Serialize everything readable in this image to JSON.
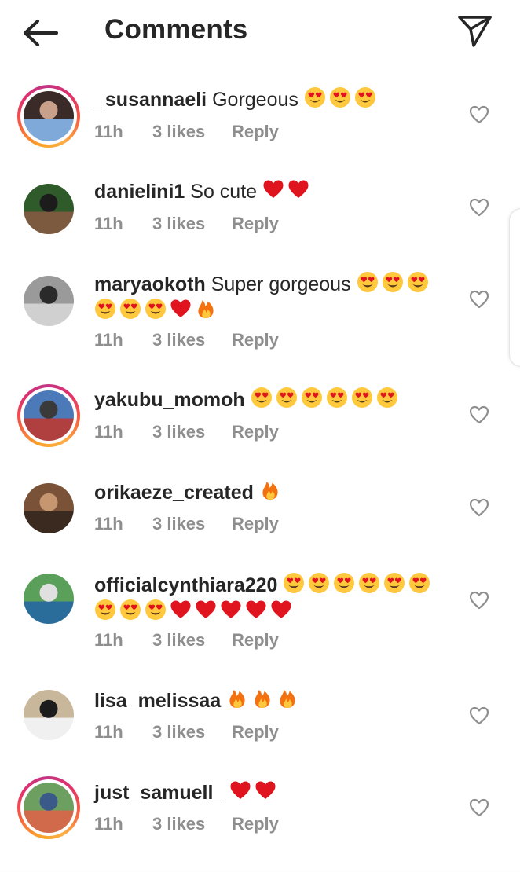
{
  "header": {
    "title": "Comments",
    "back_icon": "arrow-left-icon",
    "send_icon": "paper-plane-icon"
  },
  "colors": {
    "text": "#262626",
    "meta": "#8e8e8e",
    "story_ring": [
      "#f9a22a",
      "#e1306c",
      "#c13584"
    ],
    "heart_emoji": "#e0141e",
    "heart_eyes_face": "#ffc83d"
  },
  "comments": [
    {
      "username": "_susannaeli",
      "text": "Gorgeous",
      "emojis": [
        "heart-eyes",
        "heart-eyes",
        "heart-eyes"
      ],
      "time": "11h",
      "likes": "3 likes",
      "reply": "Reply",
      "story": true
    },
    {
      "username": "danielini1",
      "text": "So cute",
      "emojis": [
        "red-heart",
        "red-heart"
      ],
      "time": "11h",
      "likes": "3 likes",
      "reply": "Reply",
      "story": false
    },
    {
      "username": "maryaokoth",
      "text": "Super gorgeous",
      "emojis": [
        "heart-eyes",
        "heart-eyes",
        "heart-eyes",
        "heart-eyes",
        "heart-eyes",
        "heart-eyes",
        "red-heart",
        "fire"
      ],
      "time": "11h",
      "likes": "3 likes",
      "reply": "Reply",
      "story": false
    },
    {
      "username": "yakubu_momoh",
      "text": "",
      "emojis": [
        "heart-eyes",
        "heart-eyes",
        "heart-eyes",
        "heart-eyes",
        "heart-eyes",
        "heart-eyes"
      ],
      "time": "11h",
      "likes": "3 likes",
      "reply": "Reply",
      "story": true
    },
    {
      "username": "orikaeze_created",
      "text": "",
      "emojis": [
        "fire"
      ],
      "time": "11h",
      "likes": "3 likes",
      "reply": "Reply",
      "story": false
    },
    {
      "username": "officialcynthiara220",
      "text": "",
      "emojis": [
        "heart-eyes",
        "heart-eyes",
        "heart-eyes",
        "heart-eyes",
        "heart-eyes",
        "heart-eyes",
        "heart-eyes",
        "heart-eyes",
        "heart-eyes",
        "red-heart",
        "red-heart",
        "red-heart",
        "red-heart",
        "red-heart"
      ],
      "time": "11h",
      "likes": "3 likes",
      "reply": "Reply",
      "story": false
    },
    {
      "username": "lisa_melissaa",
      "text": "",
      "emojis": [
        "fire",
        "fire",
        "fire"
      ],
      "time": "11h",
      "likes": "3 likes",
      "reply": "Reply",
      "story": false
    },
    {
      "username": "just_samuell_",
      "text": "",
      "emojis": [
        "red-heart",
        "red-heart"
      ],
      "time": "11h",
      "likes": "3 likes",
      "reply": "Reply",
      "story": true
    }
  ]
}
